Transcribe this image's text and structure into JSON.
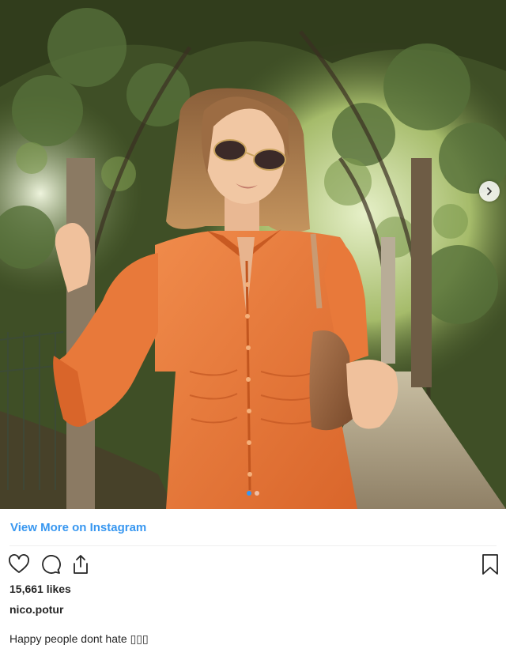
{
  "post": {
    "view_more_label": "View More on Instagram",
    "likes": "15,661 likes",
    "username": "nico.potur",
    "caption": "Happy people dont hate ▯▯▯"
  },
  "carousel": {
    "total_slides": 2,
    "active_slide": 1
  },
  "icons": {
    "like": "heart-icon",
    "comment": "comment-icon",
    "share": "share-icon",
    "save": "bookmark-icon",
    "next": "chevron-right-icon"
  },
  "colors": {
    "link": "#3897f0",
    "text": "#262626",
    "dress": "#e8793a",
    "foliage": "#4b5a2e"
  }
}
